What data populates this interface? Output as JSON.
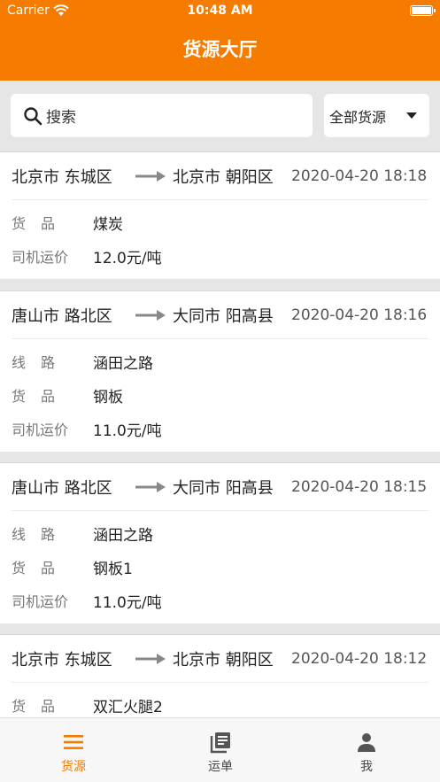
{
  "status_bar": {
    "carrier": "Carrier",
    "time": "10:48 AM"
  },
  "nav": {
    "title": "货源大厅"
  },
  "search": {
    "placeholder": "搜索",
    "filter_label": "全部货源"
  },
  "colors": {
    "accent": "#f57c00",
    "background": "#e6e6e6"
  },
  "cards": [
    {
      "from": "北京市 东城区",
      "to": "北京市 朝阳区",
      "time": "2020-04-20 18:18",
      "rows": [
        {
          "label": "货品",
          "value": "煤炭"
        },
        {
          "label": "司机运价",
          "value": "12.0元/吨"
        }
      ]
    },
    {
      "from": "唐山市 路北区",
      "to": "大同市 阳高县",
      "time": "2020-04-20 18:16",
      "rows": [
        {
          "label": "线路",
          "value": "涵田之路"
        },
        {
          "label": "货品",
          "value": "钢板"
        },
        {
          "label": "司机运价",
          "value": "11.0元/吨"
        }
      ]
    },
    {
      "from": "唐山市 路北区",
      "to": "大同市 阳高县",
      "time": "2020-04-20 18:15",
      "rows": [
        {
          "label": "线路",
          "value": "涵田之路"
        },
        {
          "label": "货品",
          "value": "钢板1"
        },
        {
          "label": "司机运价",
          "value": "11.0元/吨"
        }
      ]
    },
    {
      "from": "北京市 东城区",
      "to": "北京市 朝阳区",
      "time": "2020-04-20 18:12",
      "rows": [
        {
          "label": "货品",
          "value": "双汇火腿2"
        }
      ]
    }
  ],
  "tabs": [
    {
      "label": "货源",
      "icon": "menu-icon",
      "active": true
    },
    {
      "label": "运单",
      "icon": "waybill-icon",
      "active": false
    },
    {
      "label": "我",
      "icon": "person-icon",
      "active": false
    }
  ]
}
